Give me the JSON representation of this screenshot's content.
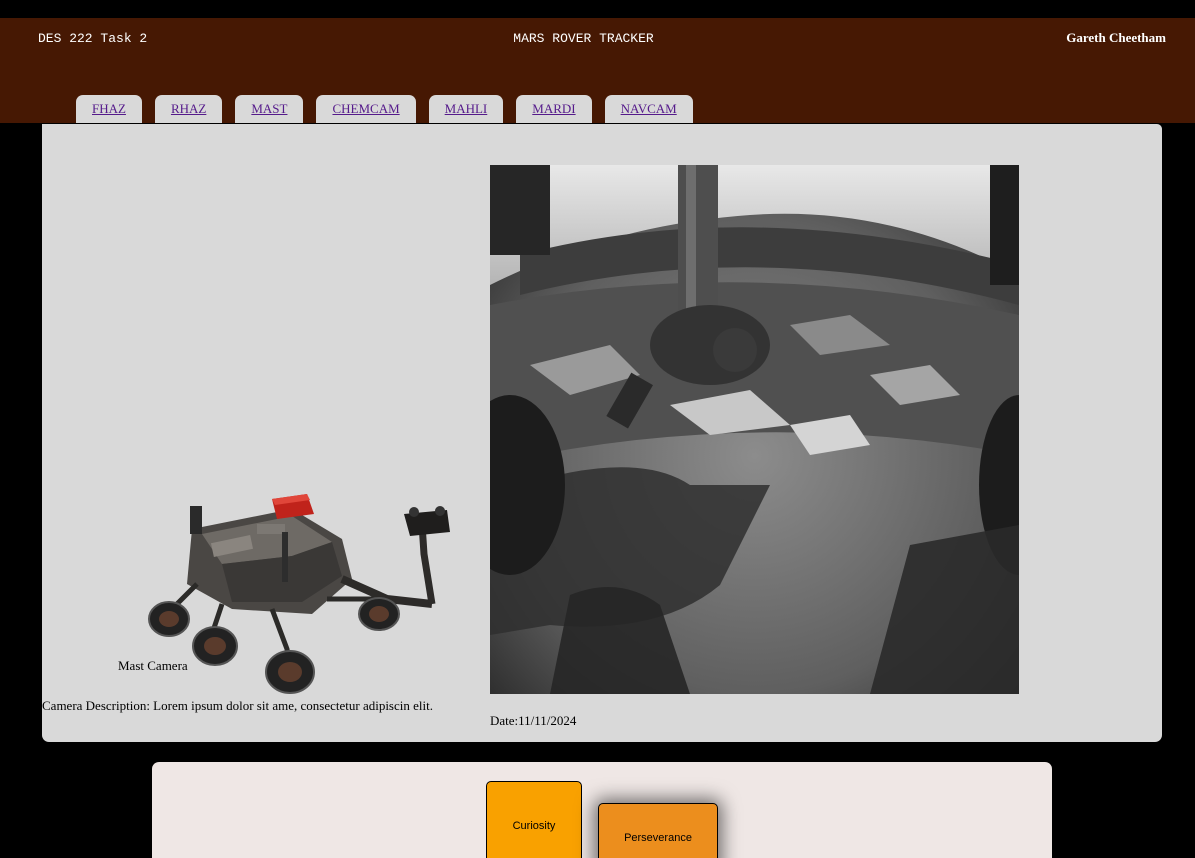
{
  "header": {
    "course": "DES 222 Task 2",
    "title": "MARS ROVER TRACKER",
    "user": "Gareth Cheetham",
    "background": "#461803"
  },
  "tabs": [
    {
      "label": "FHAZ"
    },
    {
      "label": "RHAZ"
    },
    {
      "label": "MAST"
    },
    {
      "label": "CHEMCAM"
    },
    {
      "label": "MAHLI"
    },
    {
      "label": "MARDI"
    },
    {
      "label": "NAVCAM"
    }
  ],
  "camera": {
    "name": "Mast Camera",
    "description": "Camera Description: Lorem ipsum dolor sit ame, consectetur adipiscin elit.",
    "date_label": "Date:",
    "date_value": "11/11/2024"
  },
  "rovers": {
    "items": [
      {
        "label": "Curiosity",
        "color": "#f9a100"
      },
      {
        "label": "Perseverance",
        "color": "#ec8e1d"
      }
    ]
  },
  "colors": {
    "page_bg": "#000000",
    "panel_bg": "#d9d9d9",
    "rover_panel_bg": "#efe7e5",
    "link": "#551a8b"
  }
}
